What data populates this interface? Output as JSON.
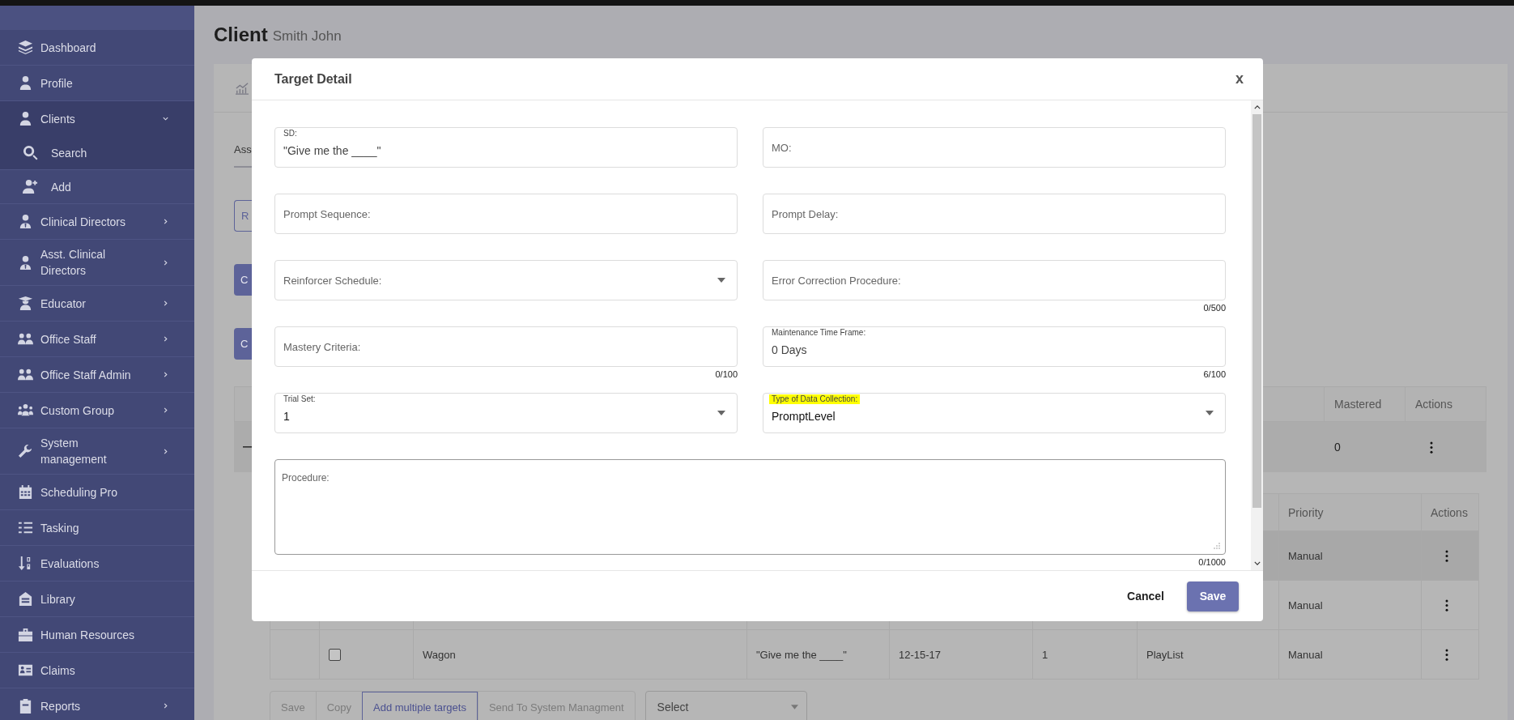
{
  "sidebar": {
    "items": [
      {
        "label": "Dashboard",
        "submenu": false,
        "expanded": false
      },
      {
        "label": "Profile",
        "submenu": false,
        "expanded": false
      },
      {
        "label": "Clients",
        "submenu": true,
        "expanded": true,
        "children": [
          {
            "label": "Search",
            "selected": true
          },
          {
            "label": "Add",
            "selected": false
          }
        ]
      },
      {
        "label": "Clinical Directors",
        "submenu": true,
        "expanded": false
      },
      {
        "label": "Asst. Clinical Directors",
        "submenu": true,
        "expanded": false
      },
      {
        "label": "Educator",
        "submenu": true,
        "expanded": false
      },
      {
        "label": "Office Staff",
        "submenu": true,
        "expanded": false
      },
      {
        "label": "Office Staff Admin",
        "submenu": true,
        "expanded": false
      },
      {
        "label": "Custom Group",
        "submenu": true,
        "expanded": false
      },
      {
        "label": "System management",
        "submenu": true,
        "expanded": false
      },
      {
        "label": "Scheduling Pro",
        "submenu": false,
        "expanded": false
      },
      {
        "label": "Tasking",
        "submenu": false,
        "expanded": false
      },
      {
        "label": "Evaluations",
        "submenu": false,
        "expanded": false
      },
      {
        "label": "Library",
        "submenu": false,
        "expanded": false
      },
      {
        "label": "Human Resources",
        "submenu": false,
        "expanded": false
      },
      {
        "label": "Claims",
        "submenu": false,
        "expanded": false
      },
      {
        "label": "Reports",
        "submenu": true,
        "expanded": false
      }
    ]
  },
  "page": {
    "title": "Client",
    "subtitle": "Smith John",
    "tab": "Ass",
    "buttons": [
      {
        "label": "R",
        "kind": "outlined"
      },
      {
        "label": "C",
        "kind": "filled"
      },
      {
        "label": "C",
        "kind": "filled"
      }
    ]
  },
  "table": {
    "columns": {
      "mastered": "Mastered",
      "actions": "Actions"
    },
    "row": {
      "mastered": "0"
    }
  },
  "sub_table": {
    "columns": {
      "priority": "Priority",
      "actions": "Actions"
    },
    "rows": [
      {
        "priority": "Manual",
        "highlighted": true
      },
      {
        "priority": "Manual",
        "highlighted": false
      },
      {
        "checked": false,
        "name": "Wagon",
        "sd": "\"Give me the ____\"",
        "date": "12-15-17",
        "trials": "1",
        "type": "PlayList",
        "priority": "Manual",
        "highlighted": false
      }
    ]
  },
  "toolbar": {
    "buttons": [
      {
        "label": "Save",
        "disabled": true
      },
      {
        "label": "Copy",
        "disabled": true
      },
      {
        "label": "Add multiple targets",
        "disabled": false
      },
      {
        "label": "Send To System Managment",
        "disabled": true
      }
    ],
    "select": {
      "placeholder": "Select"
    }
  },
  "dialog": {
    "title": "Target Detail",
    "close": "x",
    "rows": [
      {
        "fields": [
          {
            "label": "SD:",
            "value": "\"Give me the ____\"",
            "kind": "text",
            "highlighted": false
          },
          {
            "label": "MO:",
            "kind": "text",
            "highlighted": false
          }
        ]
      },
      {
        "fields": [
          {
            "label": "Prompt Sequence:",
            "kind": "text",
            "highlighted": false
          },
          {
            "label": "Prompt Delay:",
            "kind": "text",
            "highlighted": false
          }
        ]
      },
      {
        "fields": [
          {
            "label": "Reinforcer Schedule:",
            "kind": "select",
            "highlighted": false
          },
          {
            "label": "Error Correction Procedure:",
            "kind": "text",
            "counter": "0/500",
            "highlighted": false
          }
        ]
      },
      {
        "fields": [
          {
            "label": "Mastery Criteria:",
            "kind": "text",
            "counter": "0/100",
            "highlighted": false
          },
          {
            "label": "Maintenance Time Frame:",
            "value": "0 Days",
            "kind": "text",
            "counter": "6/100",
            "highlighted": false
          }
        ]
      },
      {
        "fields": [
          {
            "label": "Trial Set:",
            "value": "1",
            "kind": "select",
            "highlighted": false
          },
          {
            "label": "Type of Data Collection:",
            "value": "PromptLevel",
            "kind": "select",
            "highlighted": true
          }
        ]
      }
    ],
    "procedure": {
      "label": "Procedure:",
      "counter": "0/1000"
    },
    "buttons": [
      {
        "label": "Cancel",
        "kind": "text"
      },
      {
        "label": "Save",
        "kind": "primary"
      }
    ]
  }
}
